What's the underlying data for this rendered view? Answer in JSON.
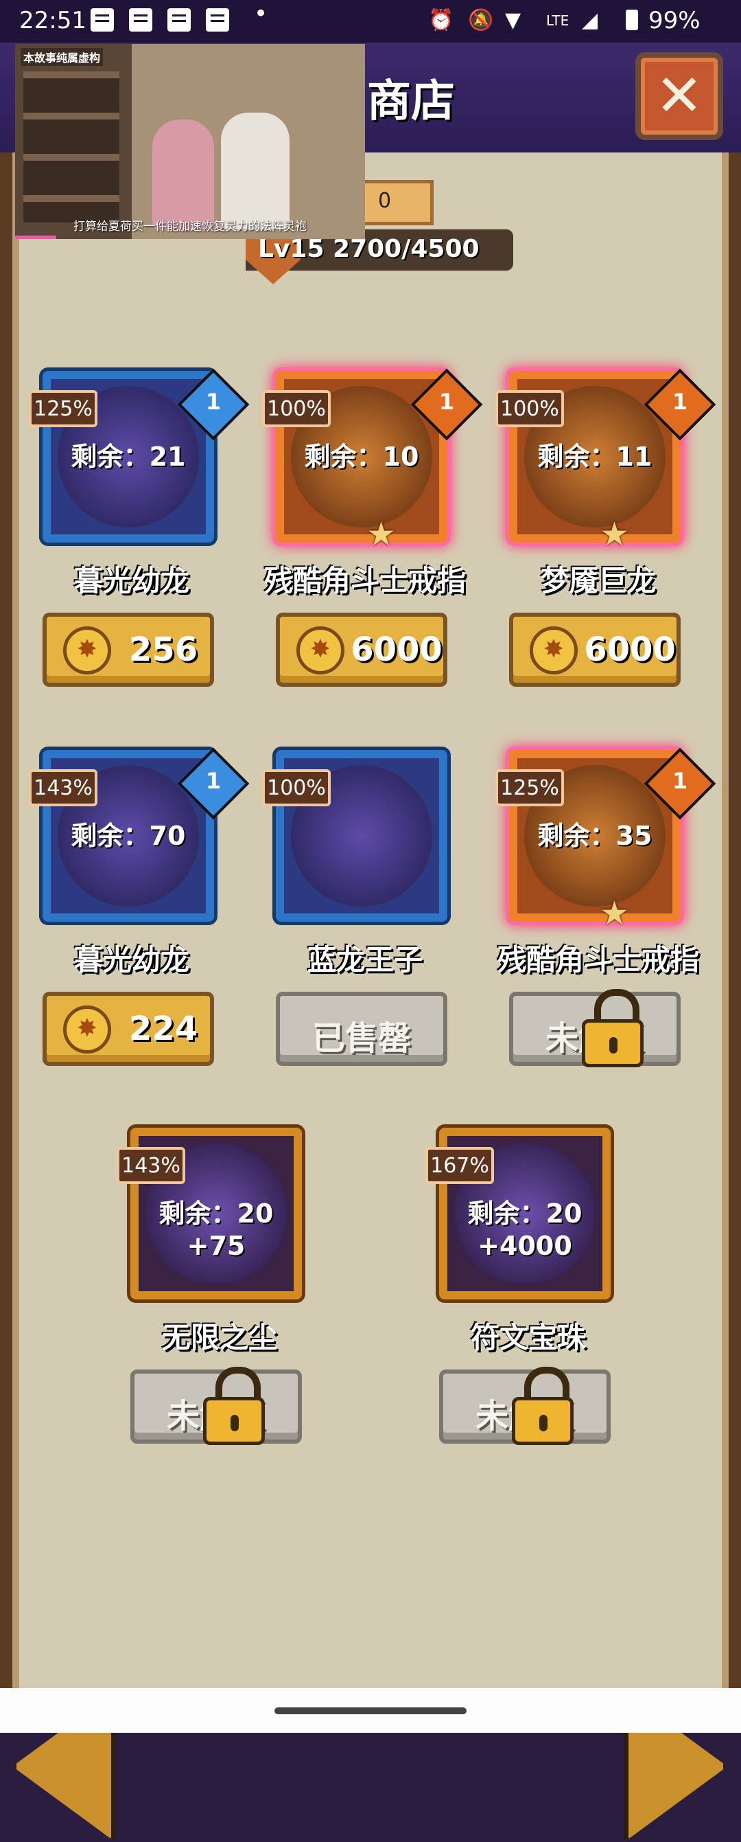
{
  "status_bar": {
    "time": "22:51",
    "battery": "99%",
    "icons": [
      "message-icon",
      "message-icon",
      "message-icon",
      "message-icon",
      "alarm-icon",
      "mute-icon",
      "wifi-icon",
      "volte-icon",
      "signal-icon",
      "battery-icon"
    ],
    "network_label": "LTE"
  },
  "header": {
    "title": "商店",
    "close_label": "✕"
  },
  "video": {
    "tag": "本故事纯属虚构",
    "caption": "打算给夏荷买一件能加速恢复灵力的法阵灵袍"
  },
  "level": {
    "text": "Lv15 2700/4500",
    "coin_value": "0"
  },
  "items": [
    {
      "name": "暮光幼龙",
      "percent": "125%",
      "remaining": "剩余：21",
      "gem": "1",
      "tier": "blue",
      "glow": false,
      "button_type": "price",
      "price": "256"
    },
    {
      "name": "残酷角斗士戒指",
      "percent": "100%",
      "remaining": "剩余：10",
      "gem": "1",
      "tier": "orange",
      "glow": true,
      "button_type": "price",
      "price": "6000"
    },
    {
      "name": "梦魇巨龙",
      "percent": "100%",
      "remaining": "剩余：11",
      "gem": "1",
      "tier": "orange",
      "glow": true,
      "button_type": "price",
      "price": "6000"
    },
    {
      "name": "暮光幼龙",
      "percent": "143%",
      "remaining": "剩余：70",
      "gem": "1",
      "tier": "blue",
      "glow": false,
      "button_type": "price",
      "price": "224"
    },
    {
      "name": "蓝龙王子",
      "percent": "100%",
      "remaining": "",
      "gem": "",
      "tier": "blue",
      "glow": false,
      "button_type": "sold",
      "label": "已售罄"
    },
    {
      "name": "残酷角斗士戒指",
      "percent": "125%",
      "remaining": "剩余：35",
      "gem": "1",
      "tier": "orange",
      "glow": true,
      "button_type": "locked",
      "label": "未解锁"
    },
    {
      "name": "无限之尘",
      "percent": "143%",
      "remaining": "剩余：20",
      "bonus": "+75",
      "tier": "gold",
      "glow": false,
      "button_type": "locked",
      "label": "未解锁"
    },
    {
      "name": "符文宝珠",
      "percent": "167%",
      "remaining": "剩余：20",
      "bonus": "+4000",
      "tier": "gold",
      "glow": false,
      "button_type": "locked",
      "label": "未解锁"
    }
  ],
  "colors": {
    "blue_frame": "#2c75c9",
    "orange_frame": "#f0812c",
    "gold_frame": "#d58a24",
    "glow": "#ff3f7f",
    "price_button": "#e6b343",
    "grey_button": "#c8c4ba"
  }
}
